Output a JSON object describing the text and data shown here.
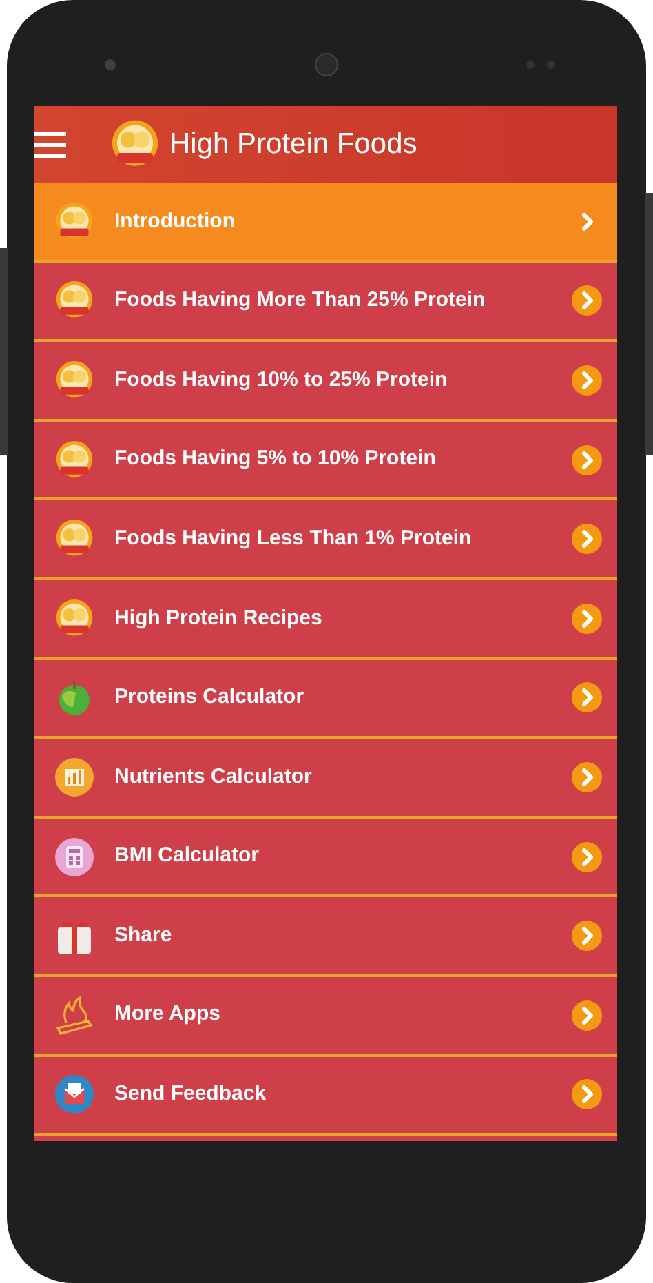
{
  "app_bar": {
    "title": "High Protein Foods"
  },
  "menu": [
    {
      "label": "Introduction",
      "kind": "logo",
      "selected": true
    },
    {
      "label": "Foods Having More Than 25% Protein",
      "kind": "logo",
      "selected": false
    },
    {
      "label": "Foods Having 10% to 25% Protein",
      "kind": "logo",
      "selected": false
    },
    {
      "label": "Foods Having 5% to 10% Protein",
      "kind": "logo",
      "selected": false
    },
    {
      "label": "Foods Having Less Than 1% Protein",
      "kind": "logo",
      "selected": false
    },
    {
      "label": "High Protein Recipes",
      "kind": "logo",
      "selected": false
    },
    {
      "label": "Proteins Calculator",
      "kind": "apple",
      "selected": false
    },
    {
      "label": "Nutrients Calculator",
      "kind": "chart",
      "selected": false
    },
    {
      "label": "BMI Calculator",
      "kind": "calculator",
      "selected": false
    },
    {
      "label": "Share",
      "kind": "gift",
      "selected": false
    },
    {
      "label": "More Apps",
      "kind": "fire",
      "selected": false
    },
    {
      "label": "Send Feedback",
      "kind": "mail",
      "selected": false
    }
  ]
}
